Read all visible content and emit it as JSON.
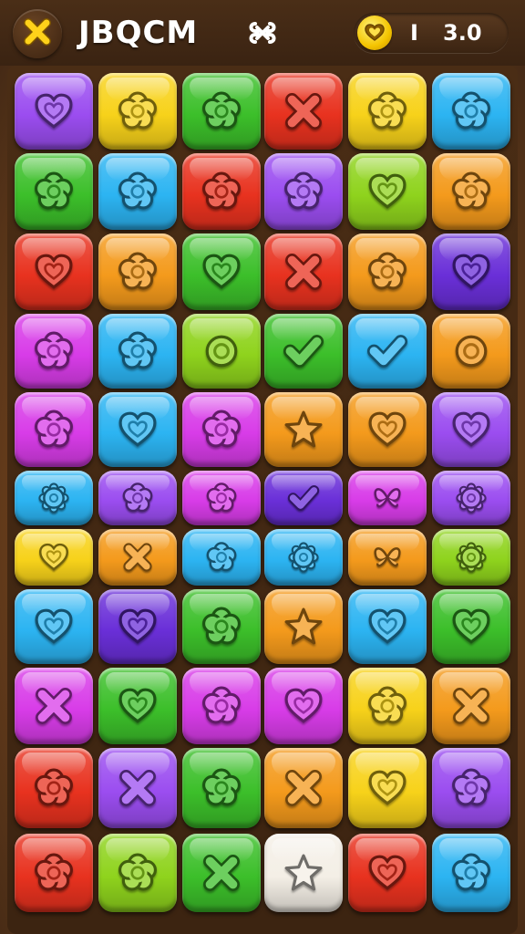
{
  "header": {
    "title": "JBQCM",
    "level": "I",
    "score": "3.0"
  },
  "icons": {
    "close": "close-x-icon",
    "link": "link-icon",
    "coin": "heart-coin-icon"
  },
  "colors": {
    "purple": "#9b4df0",
    "yellow": "#f7d21a",
    "green": "#3cbf2a",
    "red": "#e8321f",
    "blue": "#2cb4f2",
    "orange": "#f49a1c",
    "lime": "#8fd31d",
    "magenta": "#d83ce8",
    "violet": "#6a2fd8",
    "white": "#f4efe6"
  },
  "board": {
    "rows": [
      [
        [
          "purple",
          "heart"
        ],
        [
          "yellow",
          "flower"
        ],
        [
          "green",
          "flower"
        ],
        [
          "red",
          "cross"
        ],
        [
          "yellow",
          "flower"
        ],
        [
          "blue",
          "flower"
        ]
      ],
      [
        [
          "green",
          "flower"
        ],
        [
          "blue",
          "flower"
        ],
        [
          "red",
          "flower"
        ],
        [
          "purple",
          "flower"
        ],
        [
          "lime",
          "heart"
        ],
        [
          "orange",
          "flower"
        ]
      ],
      [
        [
          "red",
          "heart"
        ],
        [
          "orange",
          "flower"
        ],
        [
          "green",
          "heart"
        ],
        [
          "red",
          "cross"
        ],
        [
          "orange",
          "flower"
        ],
        [
          "violet",
          "heart"
        ]
      ],
      [
        [
          "magenta",
          "flower"
        ],
        [
          "blue",
          "flower"
        ],
        [
          "lime",
          "ring"
        ],
        [
          "green",
          "check"
        ],
        [
          "blue",
          "check"
        ],
        [
          "orange",
          "ring"
        ]
      ],
      [
        [
          "magenta",
          "flower"
        ],
        [
          "blue",
          "heart"
        ],
        [
          "magenta",
          "flower"
        ],
        [
          "orange",
          "star"
        ],
        [
          "orange",
          "heart"
        ],
        [
          "purple",
          "heart"
        ]
      ],
      [
        [
          "blue",
          "gear"
        ],
        [
          "purple",
          "flower"
        ],
        [
          "magenta",
          "flower"
        ],
        [
          "violet",
          "check"
        ],
        [
          "magenta",
          "butterfly"
        ],
        [
          "purple",
          "gear"
        ]
      ],
      [
        [
          "yellow",
          "heart"
        ],
        [
          "orange",
          "cross"
        ],
        [
          "blue",
          "flower"
        ],
        [
          "blue",
          "gear"
        ],
        [
          "orange",
          "butterfly"
        ],
        [
          "lime",
          "gear"
        ]
      ],
      [
        [
          "blue",
          "heart"
        ],
        [
          "violet",
          "heart"
        ],
        [
          "green",
          "flower"
        ],
        [
          "orange",
          "star"
        ],
        [
          "blue",
          "heart"
        ],
        [
          "green",
          "heart"
        ]
      ],
      [
        [
          "magenta",
          "cross"
        ],
        [
          "green",
          "heart"
        ],
        [
          "magenta",
          "flower"
        ],
        [
          "magenta",
          "heart"
        ],
        [
          "yellow",
          "flower"
        ],
        [
          "orange",
          "cross"
        ]
      ],
      [
        [
          "red",
          "flower"
        ],
        [
          "purple",
          "cross"
        ],
        [
          "green",
          "flower"
        ],
        [
          "orange",
          "cross"
        ],
        [
          "yellow",
          "heart"
        ],
        [
          "purple",
          "flower"
        ]
      ],
      [
        [
          "red",
          "flower"
        ],
        [
          "lime",
          "flower"
        ],
        [
          "green",
          "cross"
        ],
        [
          "white",
          "star"
        ],
        [
          "red",
          "heart"
        ],
        [
          "blue",
          "flower"
        ]
      ]
    ]
  }
}
